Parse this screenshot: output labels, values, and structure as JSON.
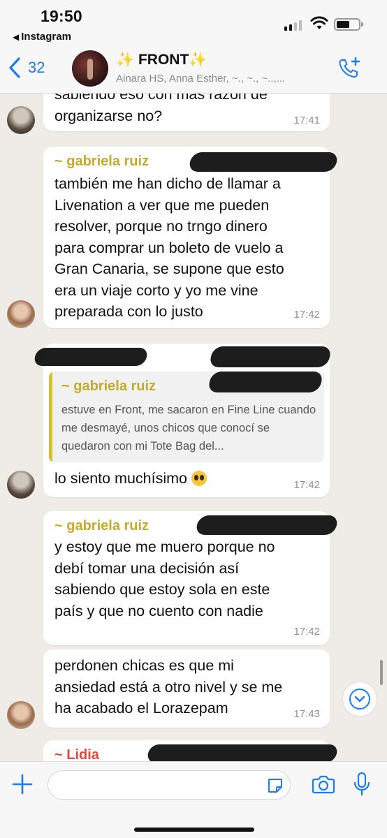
{
  "status_bar": {
    "time": "19:50",
    "back_app": "Instagram"
  },
  "header": {
    "back_count": "32",
    "title": "✨ FRONT✨",
    "subtitle": "Ainara HS, Anna Esther, ~., ~., ~..,..."
  },
  "messages": [
    {
      "text": "sabiendo eso con mas razon de\norganizarse no?",
      "time": "17:41"
    },
    {
      "sender": "~ gabriela ruiz",
      "text": "también me han dicho de llamar a\nLivenation a ver que me pueden\nresolver, porque no trngo dinero\npara comprar un boleto de vuelo a\nGran Canaria, se supone que esto\nera un viaje corto y yo me vine\npreparada con lo justo",
      "time": "17:42"
    },
    {
      "quote_name": "~ gabriela ruiz",
      "quote_text": "estuve en Front, me sacaron en Fine Line cuando me desmayé, unos chicos que conocí se quedaron con mi Tote Bag del...",
      "text": "lo siento muchísimo",
      "time": "17:42"
    },
    {
      "sender": "~ gabriela ruiz",
      "text": "y estoy que me muero porque no\ndebí tomar una decisión así\nsabiendo que estoy sola en este\npaís y que no cuento con nadie",
      "time": "17:42"
    },
    {
      "text": "perdonen chicas es que mi\nansiedad está a otro nivel y se me\nha acabado el Lorazepam",
      "time": "17:43"
    },
    {
      "sender": "~ Lidia",
      "text": ""
    }
  ],
  "input": {
    "placeholder": ""
  },
  "colors": {
    "accent": "#1a7cf5",
    "sender_gold": "#c6aa2a",
    "sender_red": "#e0493f",
    "background": "#efebe6"
  },
  "icons": [
    "chevron-left-icon",
    "call-add-icon",
    "plus-icon",
    "sticker-icon",
    "camera-icon",
    "mic-icon",
    "chevron-down-icon"
  ]
}
